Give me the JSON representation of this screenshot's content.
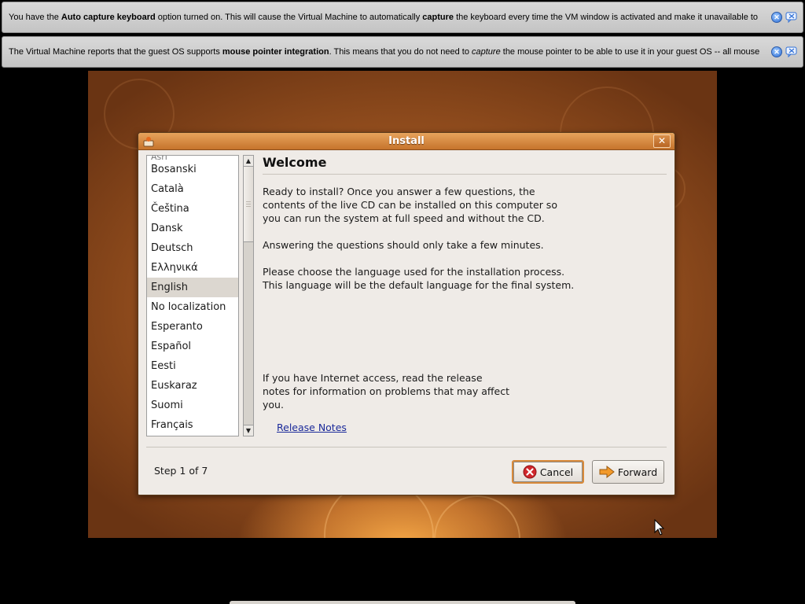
{
  "notifications": [
    {
      "pre": "You have the ",
      "bold1": "Auto capture keyboard",
      "mid": " option turned on. This will cause the Virtual Machine to automatically ",
      "bold2": "capture",
      "post": " the keyboard every time the VM window is activated and make it unavailable to"
    },
    {
      "pre": "The Virtual Machine reports that the guest OS supports ",
      "bold1": "mouse pointer integration",
      "mid": ". This means that you do not need to ",
      "italic": "capture",
      "post": " the mouse pointer to be able to use it in your guest OS -- all mouse"
    }
  ],
  "notification_close_symbol": "✕",
  "dialog": {
    "title": "Install",
    "close_symbol": "✕",
    "languages_cut_top": "Аsrl",
    "languages": [
      "Bosanski",
      "Català",
      "Čeština",
      "Dansk",
      "Deutsch",
      "Ελληνικά",
      "English",
      "No localization",
      "Esperanto",
      "Español",
      "Eesti",
      "Euskaraz",
      "Suomi",
      "Français"
    ],
    "selected_language": "English",
    "scroll_up_symbol": "▲",
    "scroll_down_symbol": "▼",
    "heading": "Welcome",
    "para1": "Ready to install? Once you answer a few questions, the\ncontents of the live CD can be installed on this computer so\nyou can run the system at full speed and without the CD.",
    "para2": "Answering the questions should only take a few minutes.",
    "para3": "Please choose the language used for the installation process.\nThis language will be the default language for the final system.",
    "para4": "If you have Internet access, read the release\nnotes for information on problems that may affect\nyou.",
    "release_notes_link": "Release Notes",
    "step": "Step 1 of 7",
    "cancel_label": "Cancel",
    "forward_label": "Forward"
  },
  "colors": {
    "titlebar": "#d98a3a",
    "dialog_bg": "#efebe7",
    "link": "#1b2a9a",
    "selection": "#dcd7d0"
  }
}
